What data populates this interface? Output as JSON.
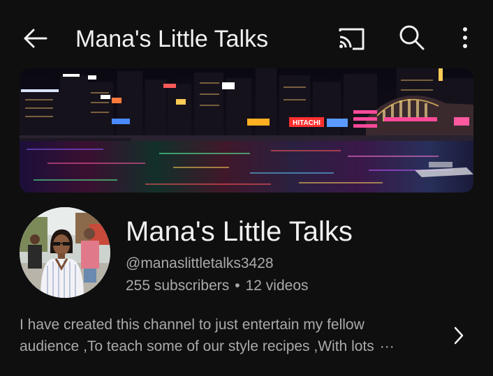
{
  "topbar": {
    "title": "Mana's Little Talks",
    "icons": {
      "back": "back-arrow-icon",
      "cast": "cast-icon",
      "search": "search-icon",
      "more": "more-vertical-icon"
    }
  },
  "banner": {
    "sign_text": "HITACHI"
  },
  "channel": {
    "name": "Mana's Little Talks",
    "handle": "@manaslittletalks3428",
    "subscribers": "255 subscribers",
    "separator": "•",
    "videos": "12 videos"
  },
  "description": {
    "line1": "I have created this channel to just entertain my fellow",
    "line2": "audience ,To teach some of our style recipes ,With lots",
    "more": "···"
  },
  "colors": {
    "background": "#0f0f0f",
    "primary_text": "#f1f1f1",
    "secondary_text": "#aaaaaa"
  }
}
